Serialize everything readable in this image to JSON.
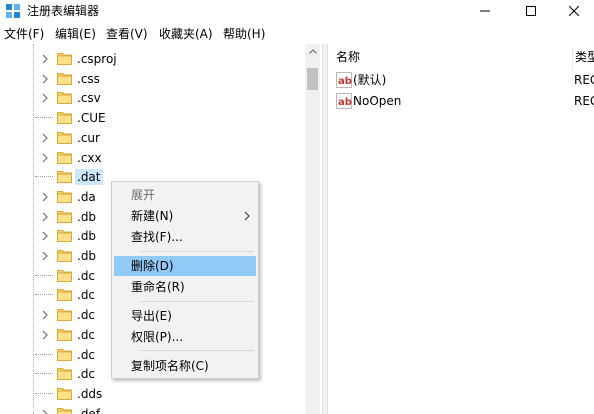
{
  "window": {
    "title": "注册表编辑器",
    "accent": "#0078d7"
  },
  "menubar": {
    "items": [
      {
        "label": "文件(F)"
      },
      {
        "label": "编辑(E)"
      },
      {
        "label": "查看(V)"
      },
      {
        "label": "收藏夹(A)"
      },
      {
        "label": "帮助(H)"
      }
    ]
  },
  "tree": {
    "items": [
      {
        "label": ".csproj",
        "expandable": true
      },
      {
        "label": ".css",
        "expandable": true
      },
      {
        "label": ".csv",
        "expandable": true
      },
      {
        "label": ".CUE",
        "expandable": false
      },
      {
        "label": ".cur",
        "expandable": true
      },
      {
        "label": ".cxx",
        "expandable": true
      },
      {
        "label": ".dat",
        "expandable": false,
        "selected": true
      },
      {
        "label": ".da",
        "expandable": true
      },
      {
        "label": ".db",
        "expandable": true
      },
      {
        "label": ".db",
        "expandable": true
      },
      {
        "label": ".db",
        "expandable": true
      },
      {
        "label": ".dc",
        "expandable": false
      },
      {
        "label": ".dc",
        "expandable": false
      },
      {
        "label": ".dc",
        "expandable": true
      },
      {
        "label": ".dc",
        "expandable": true
      },
      {
        "label": ".dc",
        "expandable": false
      },
      {
        "label": ".dc",
        "expandable": false
      },
      {
        "label": ".dds",
        "expandable": false
      },
      {
        "label": ".def",
        "expandable": true
      }
    ]
  },
  "values": {
    "columns": {
      "name": "名称",
      "type": "类型"
    },
    "rows": [
      {
        "name": "(默认)",
        "type": "REG"
      },
      {
        "name": "NoOpen",
        "type": "REG"
      }
    ]
  },
  "context_menu": {
    "items": [
      {
        "label": "展开",
        "disabled": true
      },
      {
        "label": "新建(N)",
        "submenu": true
      },
      {
        "label": "查找(F)..."
      },
      {
        "label": "删除(D)",
        "highlighted": true
      },
      {
        "label": "重命名(R)"
      },
      {
        "label": "导出(E)"
      },
      {
        "label": "权限(P)..."
      },
      {
        "label": "复制项名称(C)"
      }
    ]
  }
}
